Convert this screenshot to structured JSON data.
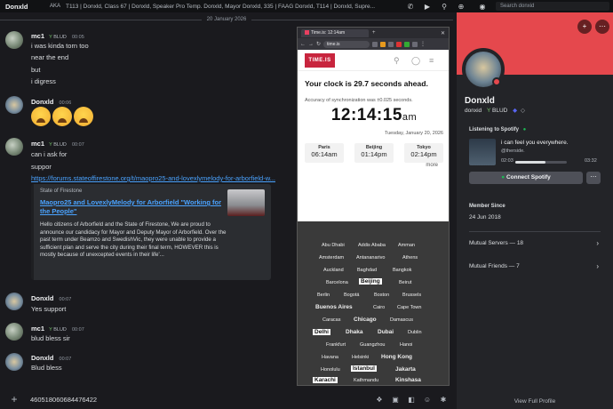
{
  "topbar": {
    "title": "Donxld",
    "aka": "AKA",
    "tags": "T113 | Donxld, Class 67 | Donxld, Speaker Pro Temp. Donxld, Mayor Donxld, 335 | FAAG Donxld, T114 | Donxld, Supre...",
    "search_placeholder": "Search donxid"
  },
  "date_divider": "20 January 2026",
  "messages": {
    "m1": {
      "author": "mc1",
      "badge": "BLUD",
      "time": "00:05",
      "lines": [
        "i was kinda torn too",
        "near the end",
        "but",
        "i digress"
      ]
    },
    "m2": {
      "author": "Donxld",
      "time": "00:06"
    },
    "m3": {
      "author": "mc1",
      "badge": "BLUD",
      "time": "00:07",
      "lines": [
        "can i ask for",
        "suppor"
      ],
      "link": "https://forums.stateoffirestone.org/t/maopro25-and-lovexlymelody-for-arborfield-w...",
      "embed": {
        "site": "State of Firestone",
        "title": "Maopro25 and LovexlyMelody for Arborfield \"Working for the People\"",
        "description": "Hello citizens of Arborfield and the State of Firestone, We are proud to announce our candidacy for Mayor and Deputy Mayor of Arborfield. Over the past term under Beamzo and SwedishVic, they were unable to provide a sufficient plan and serve the city during their final term, HOWEVER this is mostly because of unexcepted events in their life'..."
      }
    },
    "m4": {
      "author": "Donxld",
      "time": "00:07",
      "text": "Yes support"
    },
    "m5": {
      "author": "mc1",
      "badge": "BLUD",
      "time": "00:07",
      "text": "blud bless sir"
    },
    "m6": {
      "author": "Donxld",
      "time": "00:07",
      "text": "Blud bless"
    }
  },
  "input": {
    "value": "460518060684476422"
  },
  "browser": {
    "tab": "Time.is: 12:14am",
    "url": "time.is",
    "logo": "TIME.IS",
    "ahead": "Your clock is 29.7 seconds ahead.",
    "accuracy": "Accuracy of synchronization was ±0.025 seconds.",
    "clock": "12:14:15",
    "ampm": "am",
    "date": "Tuesday, January 20, 2026",
    "cities": [
      {
        "name": "Paris",
        "time": "06:14am"
      },
      {
        "name": "Beijing",
        "time": "01:14pm"
      },
      {
        "name": "Tokyo",
        "time": "02:14pm"
      }
    ],
    "more": "more",
    "cloud": {
      "abu_dhabi": "Abu Dhabi",
      "addis_ababa": "Addis Ababa",
      "amman": "Amman",
      "amsterdam": "Amsterdam",
      "antananarivo": "Antananarivo",
      "athens": "Athens",
      "auckland": "Auckland",
      "baghdad": "Baghdad",
      "bangkok": "Bangkok",
      "barcelona": "Barcelona",
      "beijing": "Beijing",
      "beirut": "Beirut",
      "berlin": "Berlin",
      "bogota": "Bogotá",
      "boston": "Boston",
      "brussels": "Brussels",
      "buenos_aires": "Buenos Aires",
      "cairo": "Cairo",
      "cape_town": "Cape Town",
      "caracas": "Caracas",
      "chicago": "Chicago",
      "damascus": "Damascus",
      "delhi": "Delhi",
      "dhaka": "Dhaka",
      "dubai": "Dubai",
      "dublin": "Dublin",
      "frankfurt": "Frankfurt",
      "guangzhou": "Guangzhou",
      "hanoi": "Hanoi",
      "havana": "Havana",
      "helsinki": "Helsinki",
      "hong_kong": "Hong Kong",
      "honolulu": "Honolulu",
      "istanbul": "Istanbul",
      "jakarta": "Jakarta",
      "karachi": "Karachi",
      "kathmandu": "Kathmandu",
      "kinshasa": "Kinshasa"
    }
  },
  "profile": {
    "name": "Donxld",
    "username": "donxid",
    "badge": "BLUD",
    "spotify_heading": "Listening to Spotify",
    "song": "i can feel you everywhere.",
    "artist": "@therside.",
    "elapsed": "02:03",
    "duration": "03:32",
    "progress": 0.58,
    "connect_label": "Connect Spotify",
    "member_since_label": "Member Since",
    "member_since": "24 Jun 2018",
    "mutual_servers": "Mutual Servers — 18",
    "mutual_friends": "Mutual Friends — 7",
    "view_full": "View Full Profile",
    "banner_color": "#e5484d"
  }
}
